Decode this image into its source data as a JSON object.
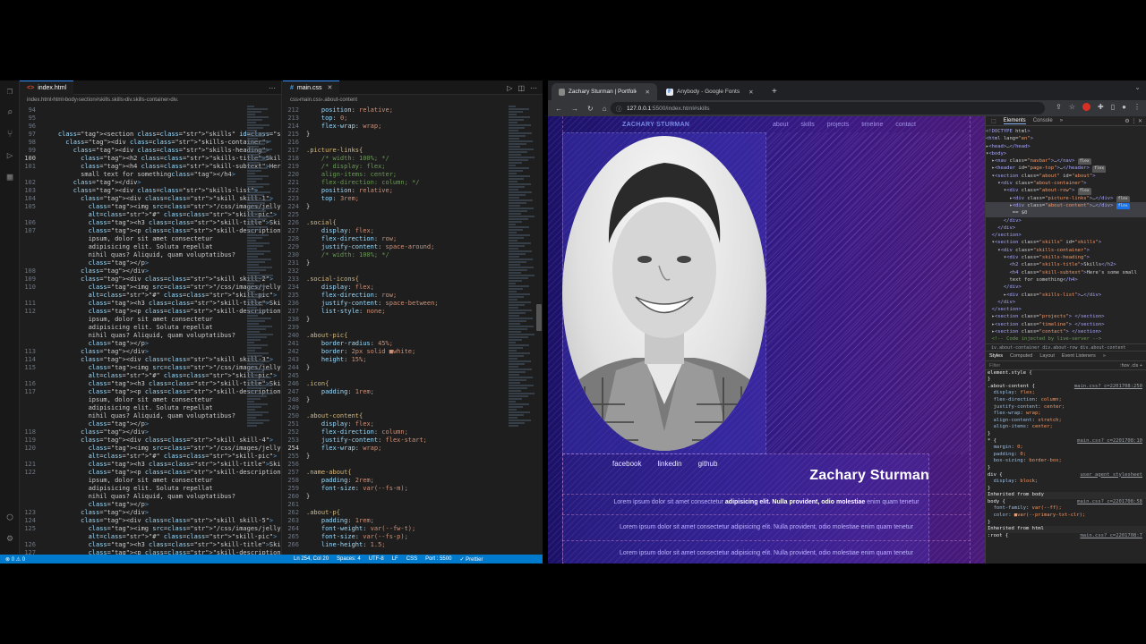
{
  "vscode": {
    "left_tabs": [
      {
        "label": "index.html",
        "active": true
      }
    ],
    "right_tabs": [
      {
        "label": "main.css",
        "active": true
      }
    ],
    "left_breadcrumb": [
      "index.html",
      "html",
      "body",
      "section#skills.skills",
      "div.skills-container",
      "div."
    ],
    "right_breadcrumb": [
      "css",
      "main.css",
      ".about-content"
    ],
    "html_lines": [
      {
        "n": "94",
        "t": ""
      },
      {
        "n": "95",
        "t": ""
      },
      {
        "n": "96",
        "t": ""
      },
      {
        "n": "97",
        "t": "    <section class=\"skills\" id=\"skills\">"
      },
      {
        "n": "98",
        "t": "      <div class=\"skills-container\">"
      },
      {
        "n": "99",
        "t": "        <div class=\"skills-heading\">"
      },
      {
        "n": "100",
        "t": "          <h2 class=\"skills-title\">Skills</h2>"
      },
      {
        "n": "101",
        "t": "          <h4 class=\"skill-subtext\">Here's some"
      },
      {
        "n": "",
        "t": "          small text for something</h4>"
      },
      {
        "n": "102",
        "t": "        </div>"
      },
      {
        "n": "103",
        "t": "        <div class=\"skills-list\">"
      },
      {
        "n": "104",
        "t": "          <div class=\"skill skill-1\">"
      },
      {
        "n": "105",
        "t": "            <img src=\"/css/images/jelly.JPG\""
      },
      {
        "n": "",
        "t": "            alt=\"#\" class=\"skill-pic\">"
      },
      {
        "n": "106",
        "t": "            <h3 class=\"skill-title\">Skill 1</h3>"
      },
      {
        "n": "107",
        "t": "            <p class=\"skill-description\">Lorem"
      },
      {
        "n": "",
        "t": "            ipsum, dolor sit amet consectetur"
      },
      {
        "n": "",
        "t": "            adipisicing elit. Soluta repellat"
      },
      {
        "n": "",
        "t": "            nihil quas? Aliquid, quam voluptatibus?"
      },
      {
        "n": "",
        "t": "            </p>"
      },
      {
        "n": "108",
        "t": "          </div>"
      },
      {
        "n": "109",
        "t": "          <div class=\"skill skill-2\">"
      },
      {
        "n": "110",
        "t": "            <img src=\"/css/images/jelly.JPG\""
      },
      {
        "n": "",
        "t": "            alt=\"#\" class=\"skill-pic\">"
      },
      {
        "n": "111",
        "t": "            <h3 class=\"skill-title\">Skill 2</h3>"
      },
      {
        "n": "112",
        "t": "            <p class=\"skill-description\">Lorem"
      },
      {
        "n": "",
        "t": "            ipsum, dolor sit amet consectetur"
      },
      {
        "n": "",
        "t": "            adipisicing elit. Soluta repellat"
      },
      {
        "n": "",
        "t": "            nihil quas? Aliquid, quam voluptatibus?"
      },
      {
        "n": "",
        "t": "            </p>"
      },
      {
        "n": "113",
        "t": "          </div>"
      },
      {
        "n": "114",
        "t": "          <div class=\"skill skill-3\">"
      },
      {
        "n": "115",
        "t": "            <img src=\"/css/images/jelly.JPG\""
      },
      {
        "n": "",
        "t": "            alt=\"#\" class=\"skill-pic\">"
      },
      {
        "n": "116",
        "t": "            <h3 class=\"skill-title\">Skill 3</h3>"
      },
      {
        "n": "117",
        "t": "            <p class=\"skill-description\">Lorem"
      },
      {
        "n": "",
        "t": "            ipsum, dolor sit amet consectetur"
      },
      {
        "n": "",
        "t": "            adipisicing elit. Soluta repellat"
      },
      {
        "n": "",
        "t": "            nihil quas? Aliquid, quam voluptatibus?"
      },
      {
        "n": "",
        "t": "            </p>"
      },
      {
        "n": "118",
        "t": "          </div>"
      },
      {
        "n": "119",
        "t": "          <div class=\"skill skill-4\">"
      },
      {
        "n": "120",
        "t": "            <img src=\"/css/images/jelly.JPG\""
      },
      {
        "n": "",
        "t": "            alt=\"#\" class=\"skill-pic\">"
      },
      {
        "n": "121",
        "t": "            <h3 class=\"skill-title\">Skill 4</h3>"
      },
      {
        "n": "122",
        "t": "            <p class=\"skill-description\">Lorem"
      },
      {
        "n": "",
        "t": "            ipsum, dolor sit amet consectetur"
      },
      {
        "n": "",
        "t": "            adipisicing elit. Soluta repellat"
      },
      {
        "n": "",
        "t": "            nihil quas? Aliquid, quam voluptatibus?"
      },
      {
        "n": "",
        "t": "            </p>"
      },
      {
        "n": "123",
        "t": "          </div>"
      },
      {
        "n": "124",
        "t": "          <div class=\"skill skill-5\">"
      },
      {
        "n": "125",
        "t": "            <img src=\"/css/images/jelly.JPG\""
      },
      {
        "n": "",
        "t": "            alt=\"#\" class=\"skill-pic\">"
      },
      {
        "n": "126",
        "t": "            <h3 class=\"skill-title\">Skill 5</h3>"
      },
      {
        "n": "127",
        "t": "            <p class=\"skill-description\">Lorem"
      }
    ],
    "current_html_line": "100",
    "css_lines": [
      {
        "n": "212",
        "t": "    position: relative;"
      },
      {
        "n": "213",
        "t": "    top: 0;"
      },
      {
        "n": "214",
        "t": "    flex-wrap: wrap;"
      },
      {
        "n": "215",
        "t": "}"
      },
      {
        "n": "216",
        "t": ""
      },
      {
        "n": "217",
        "t": ".picture-links{"
      },
      {
        "n": "218",
        "t": "    /* width: 100%; */"
      },
      {
        "n": "219",
        "t": "    /* display: flex;"
      },
      {
        "n": "220",
        "t": "    align-items: center;"
      },
      {
        "n": "221",
        "t": "    flex-direction: column; */"
      },
      {
        "n": "222",
        "t": "    position: relative;"
      },
      {
        "n": "223",
        "t": "    top: 3rem;"
      },
      {
        "n": "224",
        "t": "}"
      },
      {
        "n": "225",
        "t": ""
      },
      {
        "n": "226",
        "t": ".social{"
      },
      {
        "n": "227",
        "t": "    display: flex;"
      },
      {
        "n": "228",
        "t": "    flex-direction: row;"
      },
      {
        "n": "229",
        "t": "    justify-content: space-around;"
      },
      {
        "n": "230",
        "t": "    /* width: 100%; */"
      },
      {
        "n": "231",
        "t": "}"
      },
      {
        "n": "232",
        "t": ""
      },
      {
        "n": "233",
        "t": ".social-icons{"
      },
      {
        "n": "234",
        "t": "    display: flex;"
      },
      {
        "n": "235",
        "t": "    flex-direction: row;"
      },
      {
        "n": "236",
        "t": "    justify-content: space-between;"
      },
      {
        "n": "237",
        "t": "    list-style: none;"
      },
      {
        "n": "238",
        "t": "}"
      },
      {
        "n": "239",
        "t": ""
      },
      {
        "n": "240",
        "t": ".about-pic{"
      },
      {
        "n": "241",
        "t": "    border-radius: 45%;"
      },
      {
        "n": "242",
        "t": "    border: 2px solid ■white;"
      },
      {
        "n": "243",
        "t": "    height: 15%;"
      },
      {
        "n": "244",
        "t": "}"
      },
      {
        "n": "245",
        "t": ""
      },
      {
        "n": "246",
        "t": ".icon{"
      },
      {
        "n": "247",
        "t": "    padding: 1rem;"
      },
      {
        "n": "248",
        "t": "}"
      },
      {
        "n": "249",
        "t": ""
      },
      {
        "n": "250",
        "t": ".about-content{"
      },
      {
        "n": "251",
        "t": "    display: flex;"
      },
      {
        "n": "252",
        "t": "    flex-direction: column;"
      },
      {
        "n": "253",
        "t": "    justify-content: flex-start;"
      },
      {
        "n": "254",
        "t": "    flex-wrap: wrap;"
      },
      {
        "n": "255",
        "t": "}"
      },
      {
        "n": "256",
        "t": ""
      },
      {
        "n": "257",
        "t": ".name-about{"
      },
      {
        "n": "258",
        "t": "    padding: 2rem;"
      },
      {
        "n": "259",
        "t": "    font-size: var(--fs-m);"
      },
      {
        "n": "260",
        "t": "}"
      },
      {
        "n": "261",
        "t": ""
      },
      {
        "n": "262",
        "t": ".about-p{"
      },
      {
        "n": "263",
        "t": "    padding: 1rem;"
      },
      {
        "n": "264",
        "t": "    font-weight: var(--fw-t);"
      },
      {
        "n": "265",
        "t": "    font-size: var(--fs-p);"
      },
      {
        "n": "266",
        "t": "    line-height: 1.5;"
      }
    ],
    "current_css_line": "254",
    "status": {
      "errors": "⊗ 0 ⚠ 0",
      "position": "Ln 254, Col 20",
      "spaces": "Spaces: 4",
      "encoding": "UTF-8",
      "eol": "LF",
      "language": "CSS",
      "port": "Port : 5500",
      "formatter": "✓ Prettier"
    }
  },
  "browser": {
    "tabs": [
      {
        "label": "Zachary Sturman | Portfolio | 2",
        "active": true
      },
      {
        "label": "Anybody - Google Fonts",
        "active": false
      }
    ],
    "url_host": "127.0.0.1",
    "url_path": ":5500/index.html#skills",
    "site": {
      "brand": "ZACHARY STURMAN",
      "nav": [
        "about",
        "skills",
        "projects",
        "timeline",
        "contact"
      ],
      "social": [
        "facebook",
        "linkedin",
        "github"
      ],
      "name": "Zachary Sturman",
      "para1_plain": "Lorem ipsum dolor sit amet consectetur",
      "para1_bold": "adipisicing elit. Nulla provident, odio molestiae",
      "para1_tail": "enim quam tenetur",
      "para2": "Lorem ipsum dolor sit amet consectetur adipisicing elit. Nulla provident, odio molestiae enim quam tenetur",
      "para3": "Lorem ipsum dolor sit amet consectetur adipisicing elit. Nulla provident, odio molestiae enim quam tenetur"
    },
    "devtools": {
      "tabs": [
        "Elements",
        "Console",
        "»"
      ],
      "dom_lines": [
        "<!DOCTYPE html>",
        "<html lang=\"en\">",
        "▸<head>…</head>",
        "▾<body>",
        "  ▸<nav class=\"navbar\">…</nav>",
        "  ▸<header id=\"page-top\">…</header>",
        "  ▾<section class=\"about\" id=\"about\">",
        "    ▾<div class=\"about-container\">",
        "      ▾<div class=\"about-row\">",
        "        ▸<div class=\"picture-links\">…</div>",
        "        ▸<div class=\"about-content\">…</div>",
        "         == $0",
        "      </div>",
        "    </div>",
        "  </section>",
        "  ▾<section class=\"skills\" id=\"skills\">",
        "    ▾<div class=\"skills-container\">",
        "      ▾<div class=\"skills-heading\">",
        "        <h2 class=\"skills-title\">Skills</h2>",
        "        <h4 class=\"skill-subtext\">Here's some small",
        "        text for something</h4>",
        "      </div>",
        "      ▸<div class=\"skills-list\">…</div>",
        "    </div>",
        "  </section>",
        "  ▸<section class=\"projects\"> </section>",
        "  ▸<section class=\"timeline\"> </section>",
        "  ▸<section class=\"contact\"> </section>",
        "  <!-- Code injected by live-server -->"
      ],
      "flex_badge": "flex",
      "breadcrumb": "iv.about-container   div.about-row   div.about-content",
      "styles_tabs": [
        "Styles",
        "Computed",
        "Layout",
        "Event Listeners",
        "»"
      ],
      "filter": "Filter",
      "filter_right": ":hov .cls +",
      "rules": [
        {
          "t": "element.style {",
          "k": "s"
        },
        {
          "t": "}",
          "k": "s"
        },
        {
          "t": ".about-content {",
          "k": "s",
          "src": "main.css?_c=2201708:250"
        },
        {
          "t": "  display: flex;",
          "k": "pv"
        },
        {
          "t": "  flex-direction: column;",
          "k": "pv"
        },
        {
          "t": "  justify-content: center;",
          "k": "pv"
        },
        {
          "t": "  flex-wrap: wrap;",
          "k": "pv"
        },
        {
          "t": "  align-content: stretch;",
          "k": "pv"
        },
        {
          "t": "  align-items: center;",
          "k": "pv"
        },
        {
          "t": "}",
          "k": "s"
        },
        {
          "t": "* {",
          "k": "s",
          "src": "main.css?_c=2201708:10"
        },
        {
          "t": "  margin: 0;",
          "k": "pv"
        },
        {
          "t": "  padding: 0;",
          "k": "pv"
        },
        {
          "t": "  box-sizing: border-box;",
          "k": "pv"
        },
        {
          "t": "}",
          "k": "s"
        },
        {
          "t": "div {",
          "k": "s",
          "src": "user agent stylesheet"
        },
        {
          "t": "  display: block;",
          "k": "pv"
        },
        {
          "t": "}",
          "k": "s"
        },
        {
          "t": "Inherited from body",
          "k": "inh"
        },
        {
          "t": "body {",
          "k": "s",
          "src": "main.css?_c=2201708:58"
        },
        {
          "t": "  font-family: var(--ff);",
          "k": "pv"
        },
        {
          "t": "  color: ■var(--primary-txt-clr);",
          "k": "pv"
        },
        {
          "t": "}",
          "k": "s"
        },
        {
          "t": "Inherited from html",
          "k": "inh"
        },
        {
          "t": ":root {",
          "k": "s",
          "src": "main.css?_c=2201708:7"
        }
      ]
    }
  }
}
